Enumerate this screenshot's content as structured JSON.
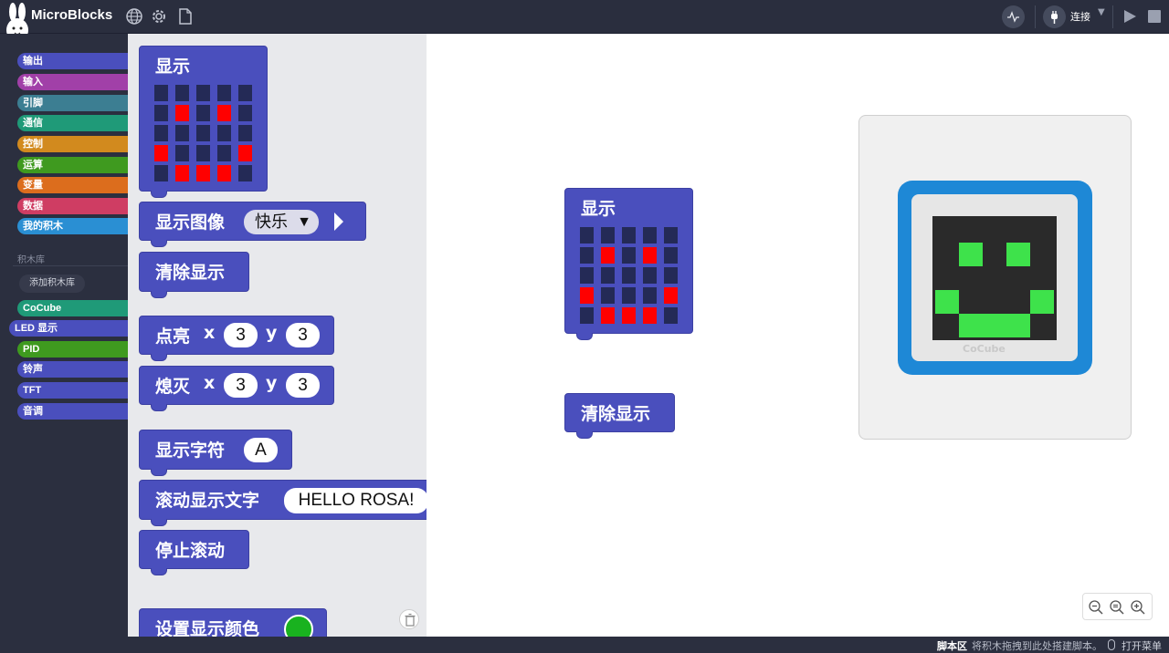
{
  "app": {
    "title": "MicroBlocks"
  },
  "toolbar": {
    "connect_label": "连接"
  },
  "categories": [
    {
      "label": "输出",
      "color": "#4a4fbd"
    },
    {
      "label": "输入",
      "color": "#a140a8"
    },
    {
      "label": "引脚",
      "color": "#3c7e92"
    },
    {
      "label": "通信",
      "color": "#1f9a78"
    },
    {
      "label": "控制",
      "color": "#d28a1e"
    },
    {
      "label": "运算",
      "color": "#3f9a1f"
    },
    {
      "label": "变量",
      "color": "#dc6d1d"
    },
    {
      "label": "数据",
      "color": "#cf3d63"
    },
    {
      "label": "我的积木",
      "color": "#2a8fd3"
    }
  ],
  "library": {
    "heading": "积木库",
    "add_button": "添加积木库",
    "items": [
      {
        "label": "CoCube",
        "color": "#1f9a78"
      },
      {
        "label": "LED 显示",
        "color": "#4a4fbd"
      },
      {
        "label": "PID",
        "color": "#3f9a1f"
      },
      {
        "label": "铃声",
        "color": "#4a4fbd"
      },
      {
        "label": "TFT",
        "color": "#4a4fbd"
      },
      {
        "label": "音调",
        "color": "#4a4fbd"
      }
    ]
  },
  "palette": {
    "display_label": "显示",
    "display_image_label": "显示图像",
    "display_image_value": "快乐",
    "clear_label": "清除显示",
    "plot_label": "点亮",
    "unplot_label": "熄灭",
    "x_label": "x",
    "y_label": "y",
    "x_value": "3",
    "y_value": "3",
    "show_char_label": "显示字符",
    "show_char_value": "A",
    "scroll_label": "滚动显示文字",
    "scroll_value": "HELLO ROSA!",
    "stop_scroll_label": "停止滚动",
    "set_color_label": "设置显示颜色",
    "set_color_value": "#19b21f"
  },
  "face_pattern": [
    [
      0,
      0,
      0,
      0,
      0
    ],
    [
      0,
      1,
      0,
      1,
      0
    ],
    [
      0,
      0,
      0,
      0,
      0
    ],
    [
      1,
      0,
      0,
      0,
      1
    ],
    [
      0,
      1,
      1,
      1,
      0
    ]
  ],
  "script": {
    "display_label": "显示",
    "clear_label": "清除显示"
  },
  "simulator": {
    "brand": "CoCube",
    "led_color": "#3ee24b"
  },
  "statusbar": {
    "title": "脚本区",
    "hint": "将积木拖拽到此处搭建脚本。",
    "menu": "打开菜单"
  }
}
